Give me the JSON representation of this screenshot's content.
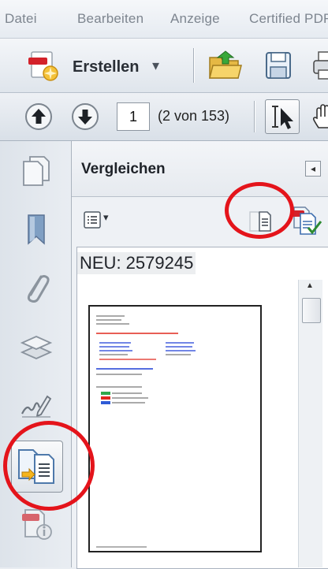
{
  "menu": {
    "items": [
      "Datei",
      "Bearbeiten",
      "Anzeige",
      "Certified PDF"
    ]
  },
  "toolbar": {
    "create_label": "Erstellen",
    "dropdown_glyph": "▾"
  },
  "nav": {
    "page_number": "1",
    "page_info": "(2 von 153)"
  },
  "panel": {
    "title": "Vergleichen",
    "collapse_glyph": "◂",
    "options_glyph": "▾",
    "document_label": "NEU: 2579245"
  },
  "scrollbar": {
    "up_glyph": "▲"
  },
  "colors": {
    "highlight_circle": "#e4141b",
    "link_blue": "#1d3fd6",
    "alert_red": "#e0281e"
  },
  "icons": [
    "create-pdf-icon",
    "open-folder-icon",
    "save-icon",
    "print-icon",
    "previous-page-icon",
    "next-page-icon",
    "select-tool-icon",
    "hand-tool-icon",
    "pages-icon",
    "bookmark-icon",
    "attachment-icon",
    "layers-icon",
    "signature-icon",
    "compare-icon",
    "document-info-icon",
    "compare-documents-icon",
    "compare-report-icon"
  ]
}
